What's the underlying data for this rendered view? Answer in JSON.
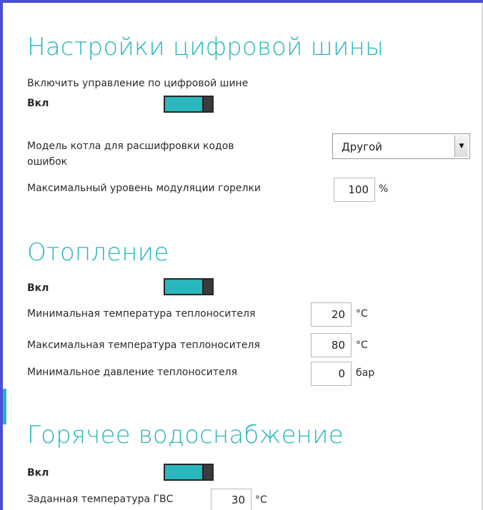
{
  "digital_bus": {
    "title": "Настройки цифровой шины",
    "enable_label": "Включить управление по цифровой шине",
    "state_label": "Вкл",
    "toggle_on": true,
    "boiler_model_label_line1": "Модель котла для расшифровки кодов",
    "boiler_model_label_line2": "ошибок",
    "boiler_model_value": "Другой",
    "modulation_label": "Максимальный уровень модуляции горелки",
    "modulation_value": "100",
    "modulation_unit": "%"
  },
  "heating": {
    "title": "Отопление",
    "state_label": "Вкл",
    "toggle_on": true,
    "min_temp_label": "Минимальная температура теплоносителя",
    "min_temp_value": "20",
    "max_temp_label": "Максимальная температура теплоносителя",
    "max_temp_value": "80",
    "temp_unit": "°C",
    "min_pressure_label": "Минимальное давление теплоносителя",
    "min_pressure_value": "0",
    "pressure_unit": "бар"
  },
  "hot_water": {
    "title": "Горячее водоснабжение",
    "state_label": "Вкл",
    "toggle_on": true,
    "target_temp_label": "Заданная температура ГВС",
    "target_temp_value": "30",
    "temp_unit": "°C"
  },
  "colors": {
    "accent": "#2ab7bd",
    "frame": "#4a4fd6",
    "toggle_dark": "#262626"
  }
}
